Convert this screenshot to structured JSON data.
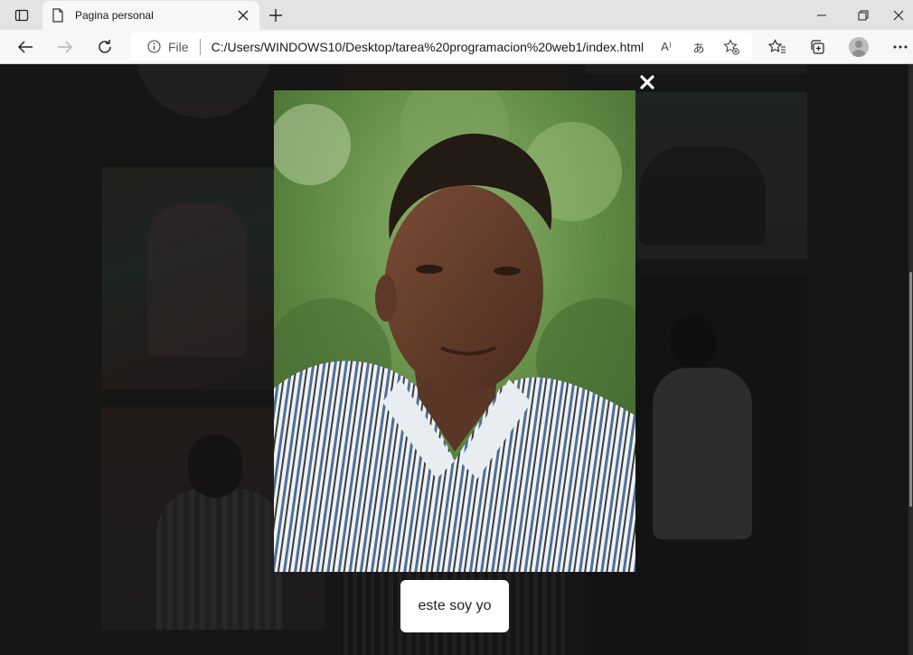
{
  "browser": {
    "tab_title": "Pagina personal",
    "address": {
      "scheme_label": "File",
      "url": "C:/Users/WINDOWS10/Desktop/tarea%20programacion%20web1/index.html"
    },
    "icons": {
      "tab_actions": "tab-actions-icon",
      "favicon": "page-icon",
      "tab_close": "close-icon",
      "new_tab": "plus-icon",
      "minimize": "minimize-icon",
      "restore": "restore-icon",
      "close_window": "close-icon",
      "back": "back-arrow-icon",
      "forward": "forward-arrow-icon",
      "reload": "reload-icon",
      "site_info": "info-icon",
      "read_aloud": "read-aloud-icon",
      "translate": "translate-icon",
      "add_favorite": "star-plus-icon",
      "favorites": "favorites-icon",
      "collections": "collections-icon",
      "profile": "profile-avatar",
      "more": "more-icon"
    },
    "read_aloud_glyph": "A⁾",
    "translate_glyph": "あ"
  },
  "lightbox": {
    "close_icon": "close-icon",
    "caption": "este soy yo"
  },
  "colors": {
    "page_background": "#1e1e1e",
    "tab_strip": "#e3e3e3",
    "toolbar": "#f7f7f7",
    "caption_background": "#ffffff"
  }
}
